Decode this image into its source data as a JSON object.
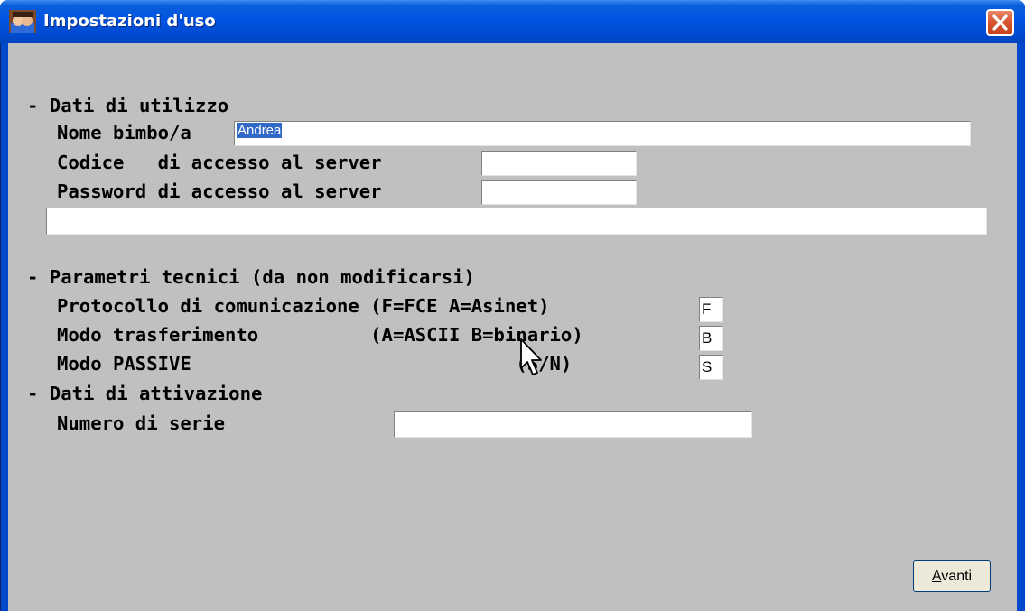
{
  "window": {
    "title": "Impostazioni d'uso"
  },
  "sections": {
    "usage": {
      "header": "- Dati di utilizzo",
      "child_name_label": "Nome bimbo/a",
      "child_name_value": "Andrea",
      "server_code_label": "Codice   di accesso al server",
      "server_code_value": "",
      "server_password_label": "Password di accesso al server",
      "server_password_value": "",
      "extra_field_value": ""
    },
    "technical": {
      "header": "- Parametri tecnici (da non modificarsi)",
      "protocol_label": "Protocollo di comunicazione (F=FCE A=Asinet)",
      "protocol_value": "F",
      "transfer_label": "Modo trasferimento          (A=ASCII B=binario)",
      "transfer_value": "B",
      "passive_label": "Modo PASSIVE                             (S/N)",
      "passive_value": "S"
    },
    "activation": {
      "header": "- Dati di attivazione",
      "serial_label": "Numero di serie",
      "serial_value": ""
    }
  },
  "buttons": {
    "next_label_accel": "A",
    "next_label_rest": "vanti"
  },
  "colors": {
    "titlebar": "#0054e3",
    "client_bg": "#c0c0c0",
    "selection": "#3169c6",
    "close_button": "#d85a36"
  }
}
